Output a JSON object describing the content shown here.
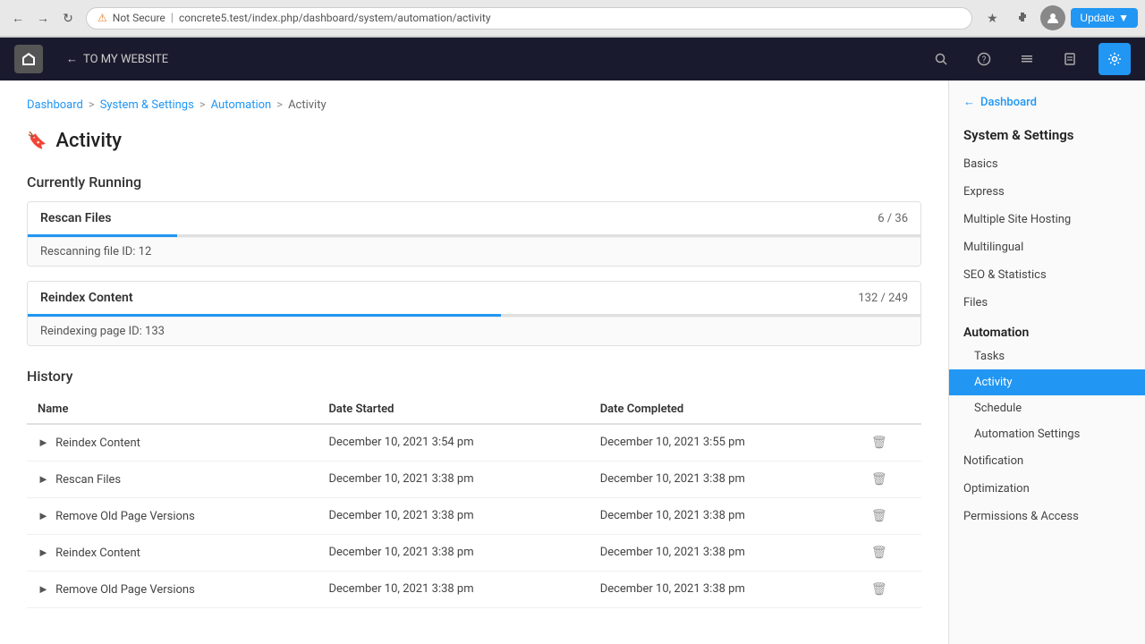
{
  "browser": {
    "url": "concrete5.test/index.php/dashboard/system/automation/activity",
    "not_secure_label": "Not Secure",
    "update_btn": "Update"
  },
  "topnav": {
    "to_my_website": "TO MY WEBSITE",
    "avatar_initial": ""
  },
  "breadcrumb": {
    "items": [
      "Dashboard",
      "System & Settings",
      "Automation",
      "Activity"
    ],
    "separators": [
      ">",
      ">",
      ">"
    ]
  },
  "page": {
    "title": "Activity"
  },
  "currently_running": {
    "section_title": "Currently Running",
    "tasks": [
      {
        "name": "Rescan Files",
        "progress_text": "6 / 36",
        "progress_percent": 16.7,
        "status": "Rescanning file ID: 12"
      },
      {
        "name": "Reindex Content",
        "progress_text": "132 / 249",
        "progress_percent": 53,
        "status": "Reindexing page ID: 133"
      }
    ]
  },
  "history": {
    "section_title": "History",
    "columns": [
      "Name",
      "Date Started",
      "Date Completed",
      ""
    ],
    "rows": [
      {
        "name": "Reindex Content",
        "date_started": "December 10, 2021 3:54 pm",
        "date_completed": "December 10, 2021 3:55 pm"
      },
      {
        "name": "Rescan Files",
        "date_started": "December 10, 2021 3:38 pm",
        "date_completed": "December 10, 2021 3:38 pm"
      },
      {
        "name": "Remove Old Page Versions",
        "date_started": "December 10, 2021 3:38 pm",
        "date_completed": "December 10, 2021 3:38 pm"
      },
      {
        "name": "Reindex Content",
        "date_started": "December 10, 2021 3:38 pm",
        "date_completed": "December 10, 2021 3:38 pm"
      },
      {
        "name": "Remove Old Page Versions",
        "date_started": "December 10, 2021 3:38 pm",
        "date_completed": "December 10, 2021 3:38 pm"
      }
    ]
  },
  "sidebar": {
    "back_label": "Dashboard",
    "section_title": "System & Settings",
    "items": [
      {
        "label": "Basics",
        "type": "item"
      },
      {
        "label": "Express",
        "type": "item"
      },
      {
        "label": "Multiple Site Hosting",
        "type": "item"
      },
      {
        "label": "Multilingual",
        "type": "item"
      },
      {
        "label": "SEO & Statistics",
        "type": "item"
      },
      {
        "label": "Files",
        "type": "item"
      },
      {
        "label": "Automation",
        "type": "group"
      },
      {
        "label": "Tasks",
        "type": "sub"
      },
      {
        "label": "Activity",
        "type": "sub",
        "active": true
      },
      {
        "label": "Schedule",
        "type": "sub"
      },
      {
        "label": "Automation Settings",
        "type": "sub"
      },
      {
        "label": "Notification",
        "type": "item"
      },
      {
        "label": "Optimization",
        "type": "item"
      },
      {
        "label": "Permissions & Access",
        "type": "item"
      }
    ]
  }
}
